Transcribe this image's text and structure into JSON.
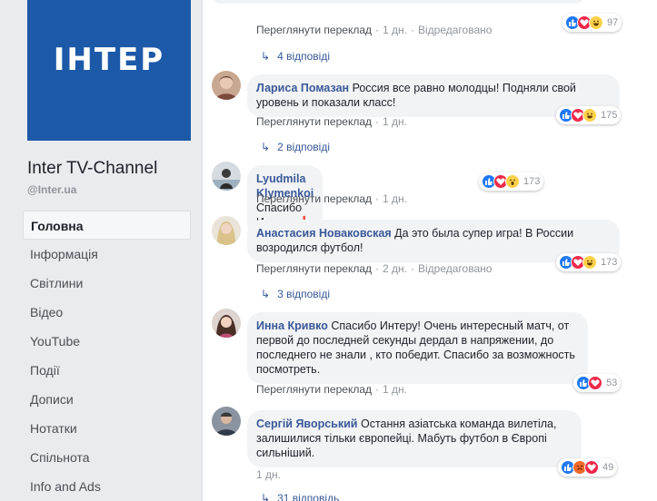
{
  "page": {
    "logo_text": "ІНТЕР",
    "name": "Inter TV-Channel",
    "handle": "@Inter.ua"
  },
  "nav": [
    {
      "label": "Головна",
      "active": true
    },
    {
      "label": "Інформація"
    },
    {
      "label": "Світлини"
    },
    {
      "label": "Відео"
    },
    {
      "label": "YouTube"
    },
    {
      "label": "Події"
    },
    {
      "label": "Дописи"
    },
    {
      "label": "Нотатки"
    },
    {
      "label": "Спільнота"
    },
    {
      "label": "Info and Ads"
    }
  ],
  "top_comment": {
    "see_translation": "Переглянути переклад",
    "time": "1 дн.",
    "edited": "Відредаговано",
    "reactions_count": "97",
    "replies": "4 відповіді"
  },
  "comments": [
    {
      "author": "Лариса Помазан",
      "text": "Россия все равно молодцы! Подняли свой уровень и показали класс!",
      "see_translation": "Переглянути переклад",
      "time": "1 дн.",
      "reactions_count": "175",
      "replies": "2 відповіді"
    },
    {
      "author": "Lyudmila Klymenkoi",
      "text": "Спасибо Интеру",
      "emoji": "❗",
      "see_translation": "Переглянути переклад",
      "time": "1 дн.",
      "reactions_count": "173"
    },
    {
      "author": "Анастасия Новаковская",
      "text": "Да это была супер игра! В России возродился футбол!",
      "see_translation": "Переглянути переклад",
      "time": "2 дн.",
      "edited": "Відредаговано",
      "reactions_count": "173",
      "replies": "3 відповіді"
    },
    {
      "author": "Инна Кривко",
      "text": "Спасибо Интеру! Очень интересный матч, от первой до последней секунды дердал в напряжении, до последнего не знали , кто победит. Спасибо за возможность посмотреть.",
      "see_translation": "Переглянути переклад",
      "time": "1 дн.",
      "reactions_count": "53"
    },
    {
      "author": "Сергій Яворський",
      "text": "Остання азіатська команда вилетіла, залишилися тільки європейці. Мабуть футбол в Європі сильніший.",
      "time": "1 дн.",
      "reactions_count": "49",
      "replies": "31 відповідь"
    }
  ],
  "colors": {
    "brand": "#1c59a8",
    "link": "#385898",
    "like": "#2078f4",
    "love": "#f0284a",
    "haha": "#fcd14b"
  }
}
